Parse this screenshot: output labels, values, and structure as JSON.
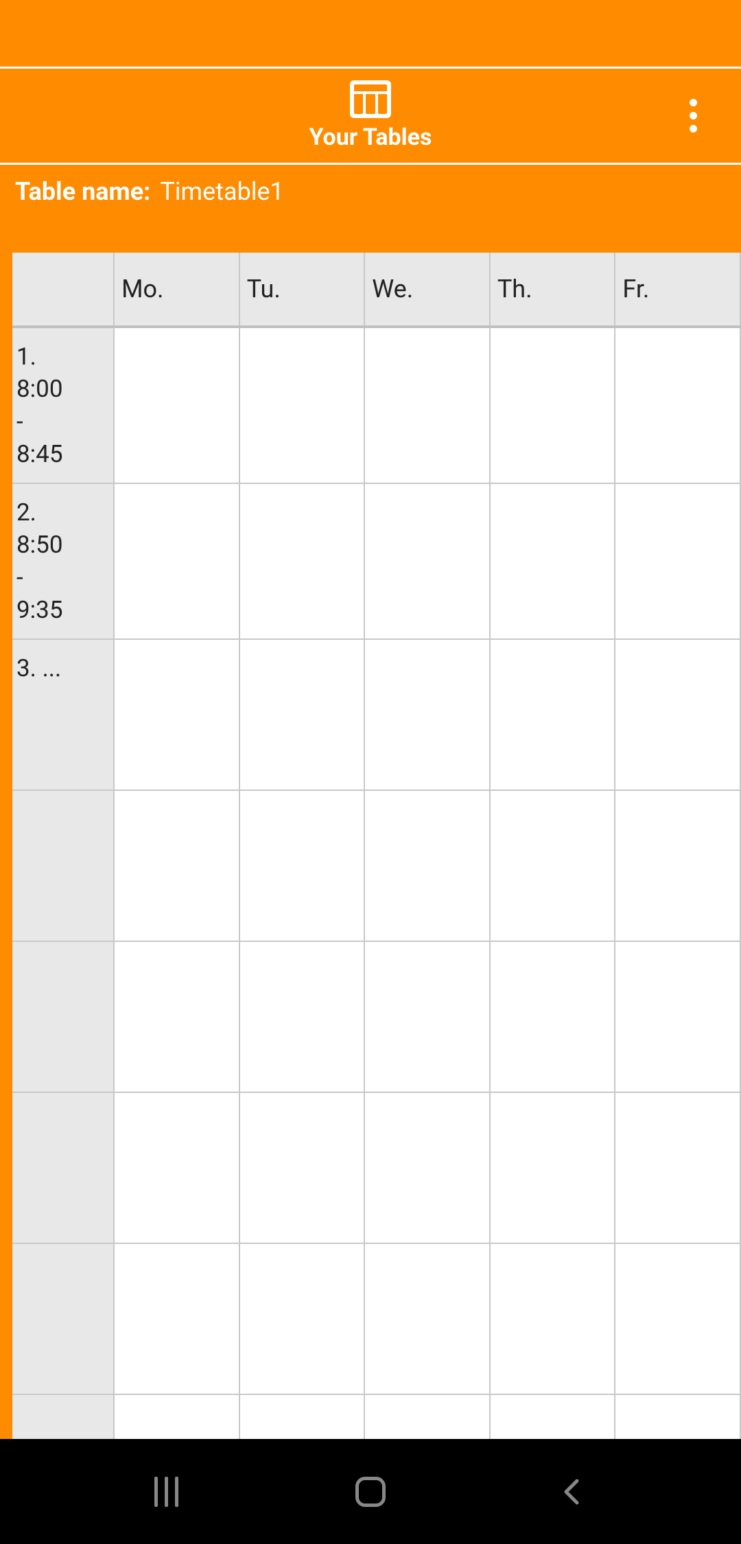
{
  "header": {
    "title": "Your Tables"
  },
  "table_name": {
    "label": "Table name:",
    "value": "Timetable1"
  },
  "timetable": {
    "days": [
      "Mo.",
      "Tu.",
      "We.",
      "Th.",
      "Fr."
    ],
    "slots": [
      "1.\n8:00\n-\n8:45",
      "2.\n8:50\n-\n9:35",
      "3. ...",
      "",
      "",
      "",
      "",
      ""
    ]
  }
}
